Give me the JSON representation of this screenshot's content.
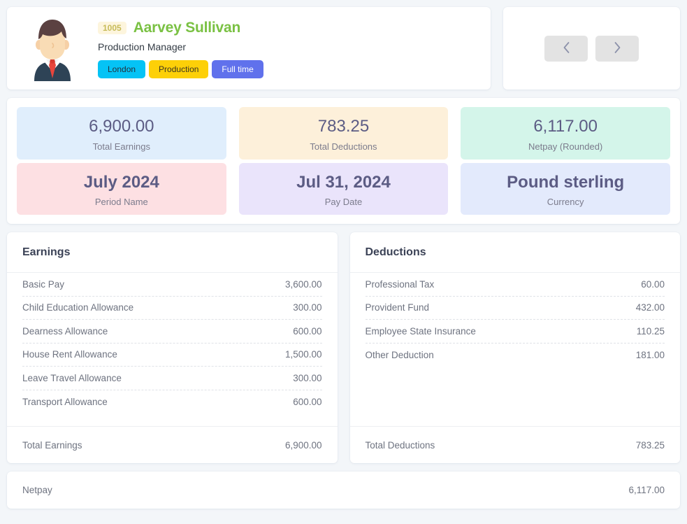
{
  "employee": {
    "id_badge": "1005",
    "name": "Aarvey Sullivan",
    "job_title": "Production Manager",
    "avatar_icon": "person-avatar-icon",
    "chips": [
      {
        "label": "London",
        "kind": "location"
      },
      {
        "label": "Production",
        "kind": "department"
      },
      {
        "label": "Full time",
        "kind": "employment-type"
      }
    ]
  },
  "navigation": {
    "previous_icon": "chevron-left-icon",
    "next_icon": "chevron-right-icon"
  },
  "summary": [
    {
      "value": "6,900.00",
      "label": "Total Earnings",
      "bg": "bg-blue",
      "bold": false
    },
    {
      "value": "783.25",
      "label": "Total Deductions",
      "bg": "bg-cream",
      "bold": false
    },
    {
      "value": "6,117.00",
      "label": "Netpay (Rounded)",
      "bg": "bg-mint",
      "bold": false
    },
    {
      "value": "July 2024",
      "label": "Period Name",
      "bg": "bg-pink",
      "bold": true
    },
    {
      "value": "Jul 31, 2024",
      "label": "Pay Date",
      "bg": "bg-lilac",
      "bold": true
    },
    {
      "value": "Pound sterling",
      "label": "Currency",
      "bg": "bg-periw",
      "bold": true
    }
  ],
  "earnings": {
    "title": "Earnings",
    "rows": [
      {
        "label": "Basic Pay",
        "amount": "3,600.00"
      },
      {
        "label": "Child Education Allowance",
        "amount": "300.00"
      },
      {
        "label": "Dearness Allowance",
        "amount": "600.00"
      },
      {
        "label": "House Rent Allowance",
        "amount": "1,500.00"
      },
      {
        "label": "Leave Travel Allowance",
        "amount": "300.00"
      },
      {
        "label": "Transport Allowance",
        "amount": "600.00"
      }
    ],
    "total_label": "Total Earnings",
    "total_amount": "6,900.00"
  },
  "deductions": {
    "title": "Deductions",
    "rows": [
      {
        "label": "Professional Tax",
        "amount": "60.00"
      },
      {
        "label": "Provident Fund",
        "amount": "432.00"
      },
      {
        "label": "Employee State Insurance",
        "amount": "110.25"
      },
      {
        "label": "Other Deduction",
        "amount": "181.00"
      }
    ],
    "total_label": "Total Deductions",
    "total_amount": "783.25"
  },
  "netpay": {
    "label": "Netpay",
    "amount": "6,117.00"
  },
  "colors": {
    "page_background": "#f3f6f9",
    "name_green": "#7ac143",
    "badge_bg": "#fdf5dd",
    "badge_text": "#c7bb58",
    "chip_location": "#05c3f5",
    "chip_department": "#fdd008",
    "chip_type": "#6071ec",
    "stat_value": "#5c5c84",
    "nav_button": "#e3e3e3"
  }
}
